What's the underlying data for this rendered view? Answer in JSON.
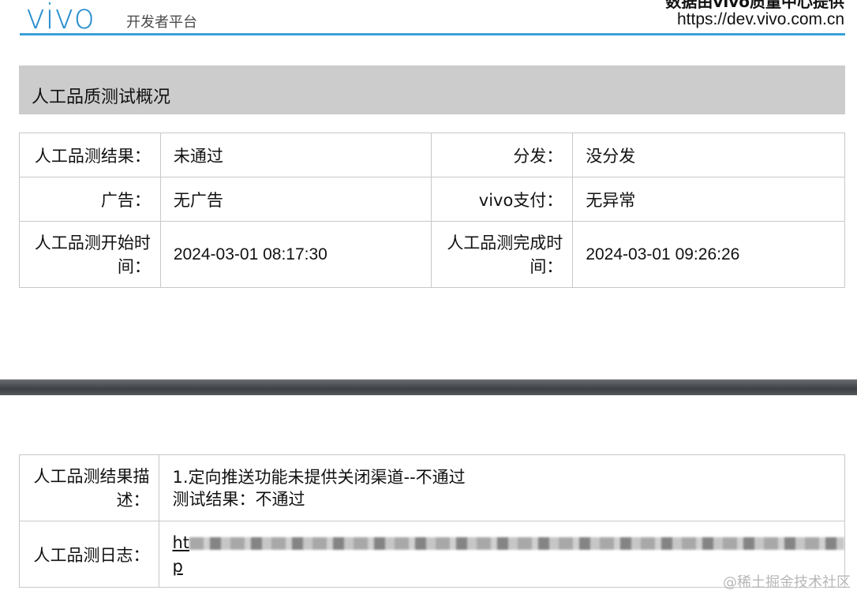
{
  "header": {
    "logo_text": "vivo",
    "logo_sub": "开发者平台",
    "top_right_partial": "数据由vivo质量中心提供",
    "url": "https://dev.vivo.com.cn"
  },
  "summary": {
    "title": "人工品质测试概况",
    "rows": [
      {
        "l1": "人工品测结果：",
        "v1": "未通过",
        "l2": "分发：",
        "v2": "没分发"
      },
      {
        "l1": "广告：",
        "v1": "无广告",
        "l2": "vivo支付：",
        "v2": "无异常"
      },
      {
        "l1a": "人工品测开始时",
        "l1b": "间：",
        "v1": "2024-03-01 08:17:30",
        "l2a": "人工品测完成时",
        "l2b": "间：",
        "v2": "2024-03-01 09:26:26"
      }
    ]
  },
  "details": {
    "desc_label_a": "人工品测结果描",
    "desc_label_b": "述：",
    "desc_line1": "1.定向推送功能未提供关闭渠道--不通过",
    "desc_line2": "测试结果：不通过",
    "log_label": "人工品测日志：",
    "log_start": "ht",
    "log_end": "p"
  },
  "watermark": "@稀土掘金技术社区"
}
